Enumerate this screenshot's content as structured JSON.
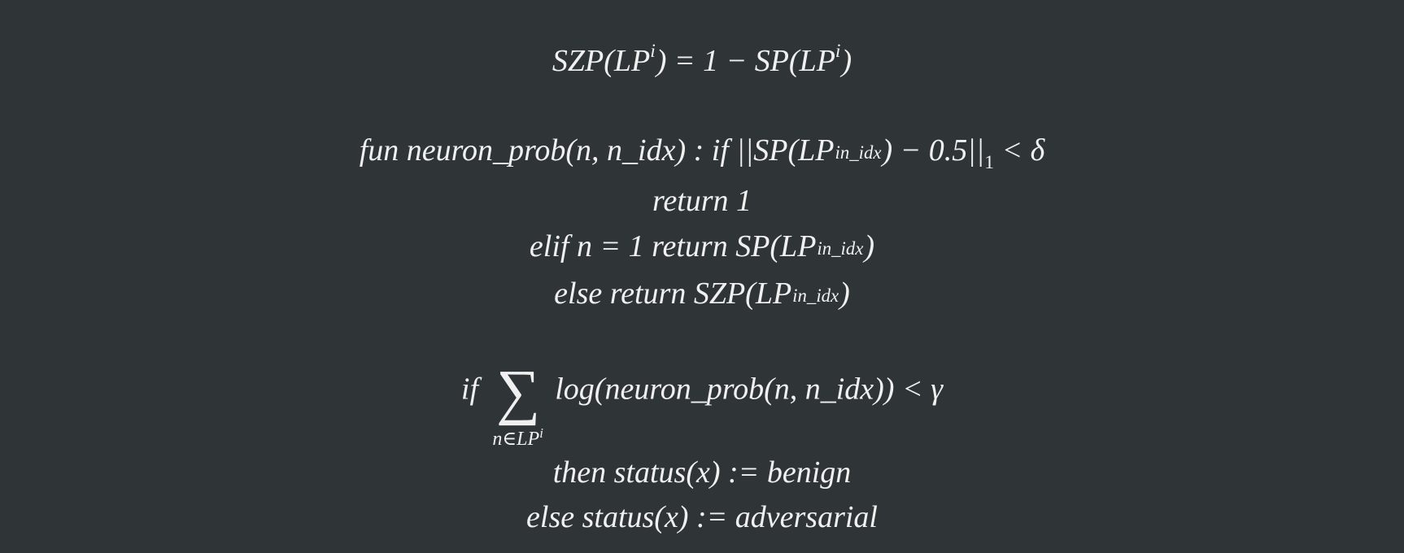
{
  "colors": {
    "background": "#2f3437",
    "text": "#f0f0f0"
  },
  "equations": {
    "szp": {
      "lhs": "SZP(LP",
      "lhs_sup": "i",
      "lhs_close": ") = 1 − SP(LP",
      "rhs_sup": "i",
      "rhs_close": ")"
    },
    "fun_def": {
      "head": "fun neuron_prob(n, n_idx) : if ||SP(LP",
      "sup": "i",
      "sub": "n_idx",
      "tail_a": ") − 0.5||",
      "norm_sub": "1",
      "tail_b": " < δ"
    },
    "return_one": "return 1",
    "elif_line": {
      "head": "elif n = 1 return SP(LP",
      "sup": "i",
      "sub": "n_idx",
      "tail": ")"
    },
    "else_line": {
      "head": "else return SZP(LP",
      "sup": "i",
      "sub": "n_idx",
      "tail": ")"
    },
    "if_sum": {
      "if_word": "if",
      "sum_symbol": "∑",
      "sum_lower": "n∈LP",
      "sum_lower_sup": "i",
      "body": "log(neuron_prob(n, n_idx)) < γ"
    },
    "then_line": "then status(x) := benign",
    "else_status": "else status(x) := adversarial"
  }
}
